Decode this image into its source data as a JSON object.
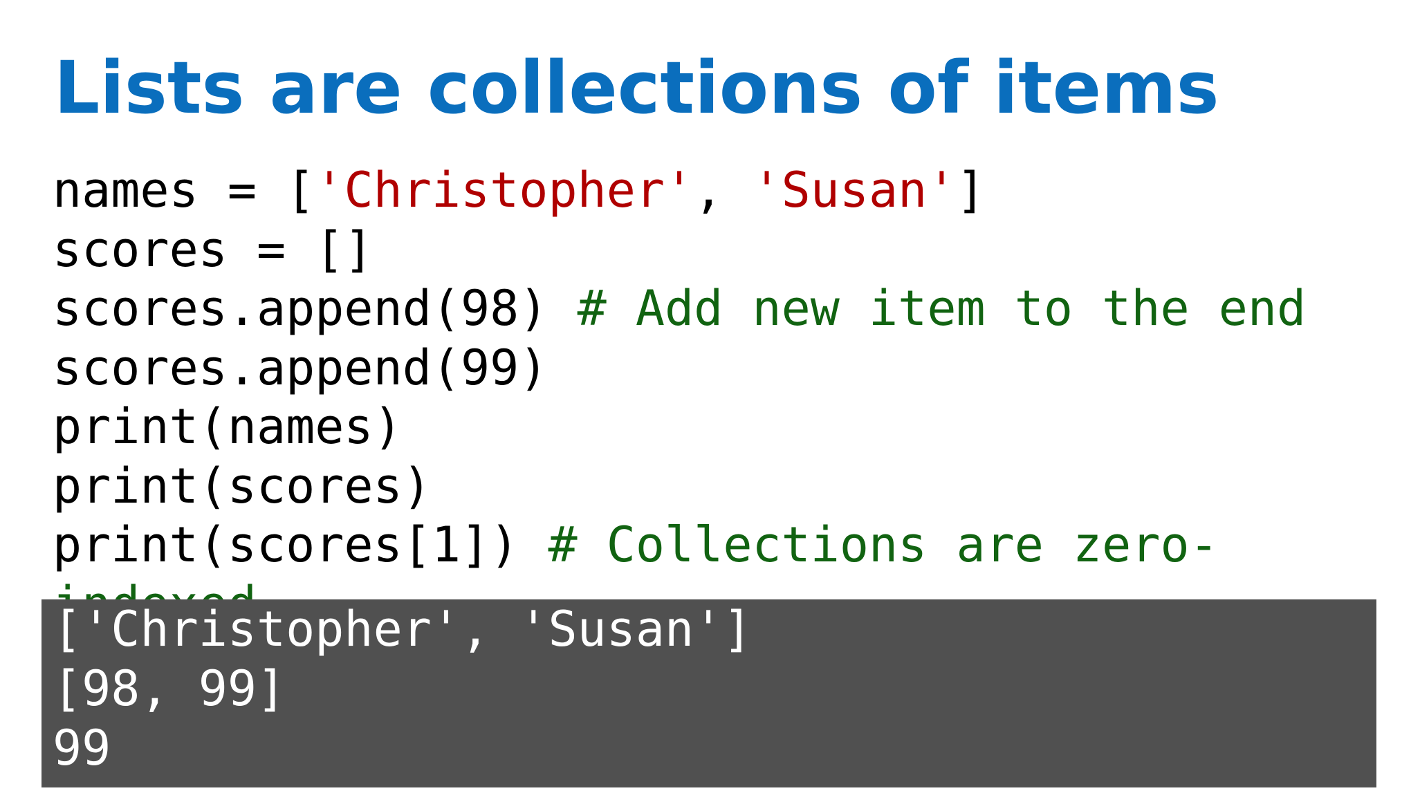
{
  "slide": {
    "title": "Lists are collections of items"
  },
  "code": {
    "line1": {
      "a": "names = [",
      "s1": "'Christopher'",
      "b": ", ",
      "s2": "'Susan'",
      "c": "]"
    },
    "line2": "scores = []",
    "line3": {
      "code": "scores.append(98) ",
      "comment": "# Add new item to the end"
    },
    "line4": "scores.append(99)",
    "line5": "print(names)",
    "line6": "print(scores)",
    "line7": {
      "code": "print(scores[1]) ",
      "comment": "# Collections are zero-"
    },
    "line8": {
      "comment": "indexed"
    }
  },
  "output": {
    "lines": [
      "['Christopher', 'Susan']",
      "[98, 99]",
      "99"
    ]
  },
  "colors": {
    "title": "#0a6ebd",
    "string": "#b00000",
    "comment": "#116311",
    "code_text": "#000000",
    "output_background": "#505050",
    "output_text": "#ffffff"
  }
}
